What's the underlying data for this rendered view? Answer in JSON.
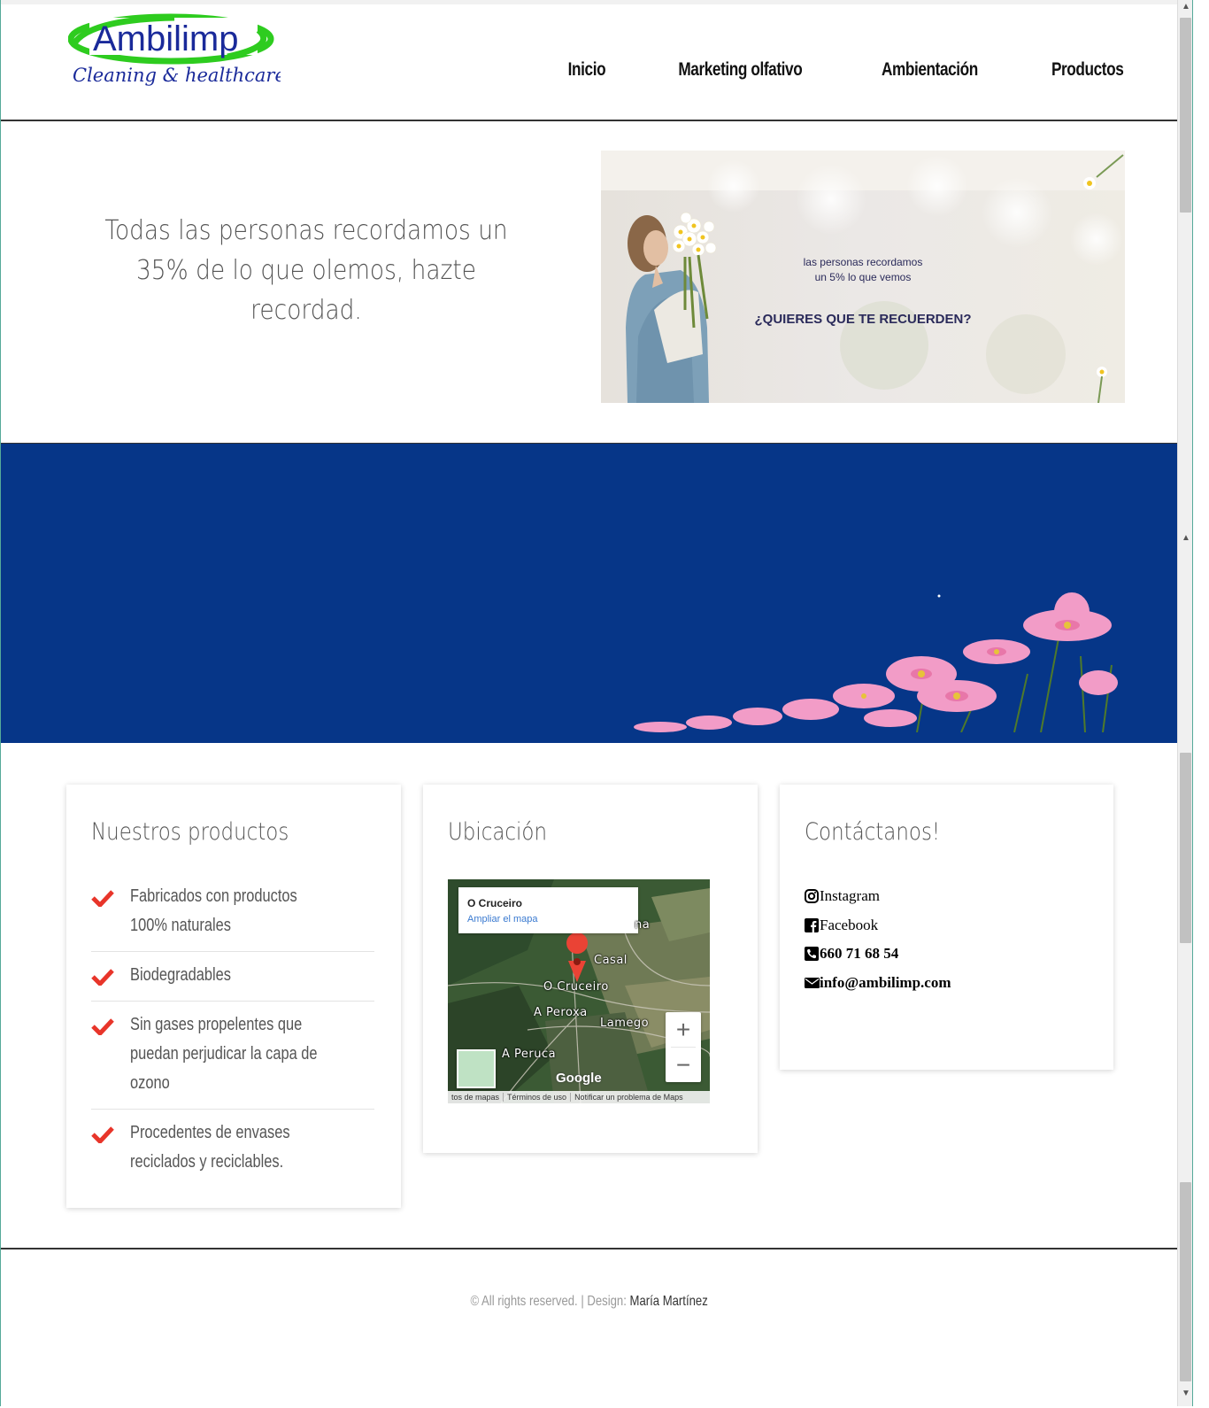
{
  "header": {
    "logo_text": "Ambilimp",
    "logo_tagline": "Cleaning & healthcare",
    "nav": [
      {
        "label": "Inicio"
      },
      {
        "label": "Marketing olfativo"
      },
      {
        "label": "Ambientación"
      },
      {
        "label": "Productos"
      }
    ]
  },
  "hero": {
    "headline": "Todas las personas recordamos un 35% de lo que olemos, hazte recordad.",
    "image_text_line1": "las personas recordamos",
    "image_text_line2": "un 5% lo que vemos",
    "image_cta": "¿QUIERES QUE TE RECUERDEN?"
  },
  "products": {
    "title": "Nuestros productos",
    "items": [
      {
        "text": "Fabricados con productos 100% naturales"
      },
      {
        "text": "Biodegradables"
      },
      {
        "text": "Sin gases propelentes que puedan perjudicar la capa de ozono"
      },
      {
        "text": "Procedentes de envases reciclados y reciclables."
      }
    ]
  },
  "location": {
    "title": "Ubicación",
    "map": {
      "place_name": "O Cruceiro",
      "enlarge_link": "Ampliar el mapa",
      "labels": [
        "Casal",
        "O Cruceiro",
        "A Peroxa",
        "Lamego",
        "A Peruca",
        "na"
      ],
      "zoom_in": "+",
      "zoom_out": "−",
      "brand": "Google",
      "footer_links": [
        "tos de mapas",
        "Términos de uso",
        "Notificar un problema de Maps"
      ]
    }
  },
  "contact": {
    "title": "Contáctanos!",
    "items": [
      {
        "icon": "instagram-icon",
        "label": "Instagram"
      },
      {
        "icon": "facebook-icon",
        "label": "Facebook"
      },
      {
        "icon": "phone-icon",
        "label": "660 71 68 54"
      },
      {
        "icon": "envelope-icon",
        "label": "info@ambilimp.com"
      }
    ]
  },
  "footer": {
    "copyright": "© All rights reserved.",
    "separator": "|",
    "design_label": "Design:",
    "designer": "María Martínez"
  },
  "colors": {
    "brand_blue": "#063688",
    "logo_green": "#2ecc1f",
    "logo_navy": "#1a2a9a",
    "check_red": "#e8352a"
  }
}
